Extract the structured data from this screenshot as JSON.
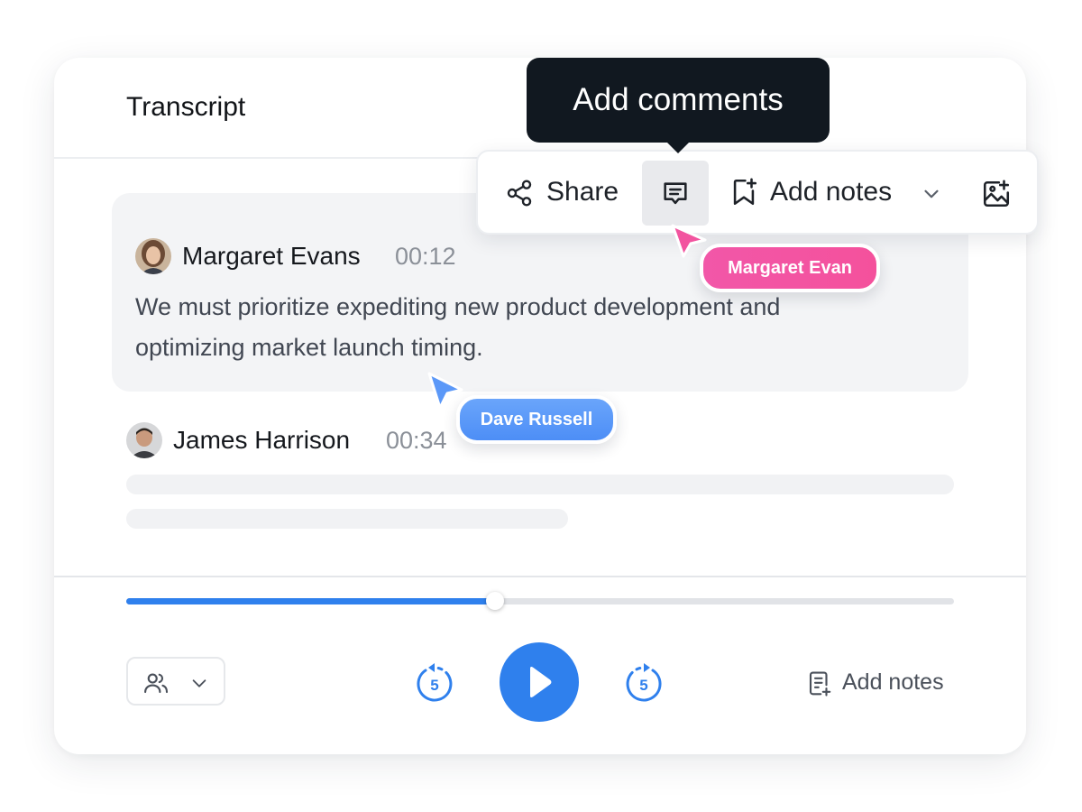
{
  "panel": {
    "title": "Transcript"
  },
  "tooltip": {
    "label": "Add comments"
  },
  "toolbar": {
    "share_label": "Share",
    "comment_icon": "comment-icon",
    "add_notes_label": "Add notes",
    "image_icon": "image-add-icon"
  },
  "transcript": {
    "entries": [
      {
        "speaker": "Margaret Evans",
        "time": "00:12",
        "text": "We must prioritize expediting new product  development and optimizing market launch timing.",
        "highlighted": true
      },
      {
        "speaker": "James Harrison",
        "time": "00:34",
        "text": "",
        "highlighted": false
      }
    ]
  },
  "collaborators": [
    {
      "name": "Margaret Evan",
      "color": "#f2549f"
    },
    {
      "name": "Dave Russell",
      "color": "#5b98f8"
    }
  ],
  "player": {
    "progress": 0.445,
    "skip_back_seconds": "5",
    "skip_forward_seconds": "5",
    "add_notes_label": "Add notes",
    "accent_color": "#2f80ed"
  }
}
